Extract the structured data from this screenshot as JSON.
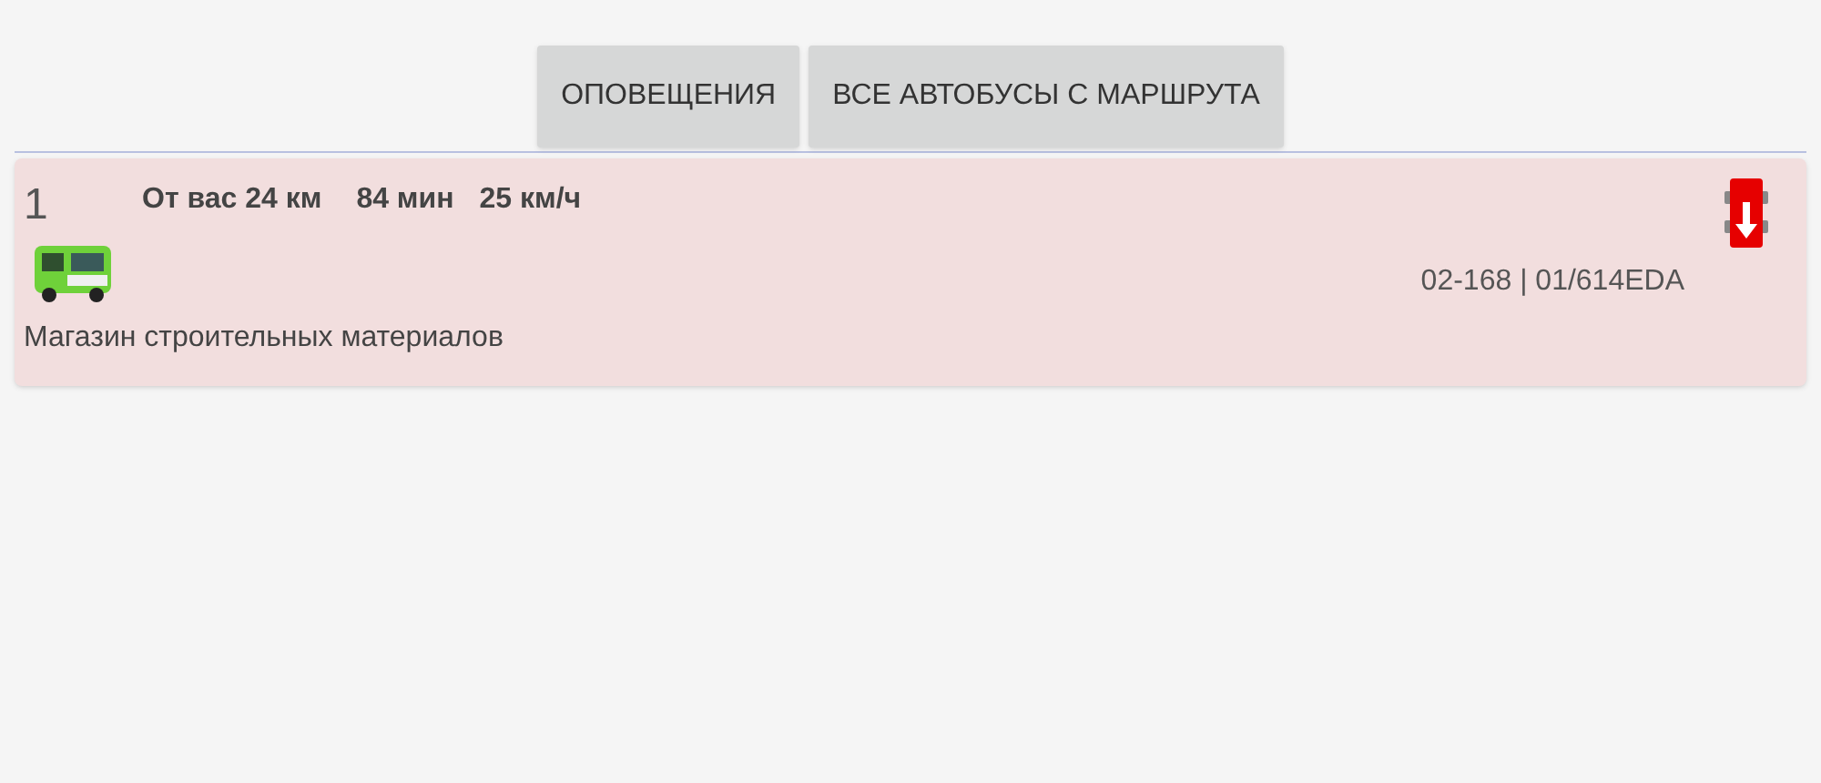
{
  "buttons": [
    "ОПОВЕЩЕНИЯ",
    "ВСЕ АВТОБУСЫ С МАРШРУТА"
  ],
  "buses": [
    {
      "number": "1",
      "distance": "От вас 24 км",
      "time": "84 мин",
      "speed": "25 км/ч",
      "plate": "02-168 | 01/614EDA",
      "stop": "Магазин строительных материалов"
    }
  ]
}
